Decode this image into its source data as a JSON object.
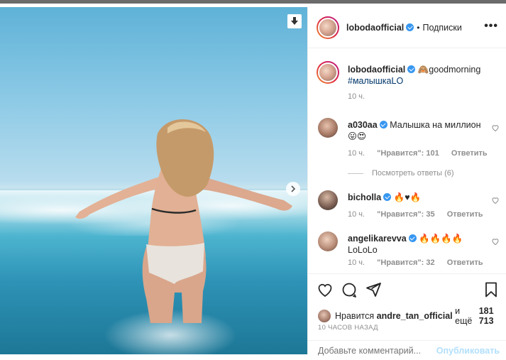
{
  "post": {
    "username": "lobodaofficial",
    "follow_label": "Подписки",
    "dot": "•",
    "more": "•••"
  },
  "caption": {
    "username": "lobodaofficial",
    "text": "🙈goodmorning",
    "hashtag": "#малышкаLO",
    "time": "10 ч."
  },
  "comments": [
    {
      "username": "a030aa",
      "text": "Малышка на миллион",
      "text2": "😛😍",
      "time": "10 ч.",
      "likes": "\"Нравится\": 101",
      "reply": "Ответить",
      "view_replies": "Посмотреть ответы (6)"
    },
    {
      "username": "bicholla",
      "text": "🔥♥🔥",
      "time": "10 ч.",
      "likes": "\"Нравится\": 35",
      "reply": "Ответить"
    },
    {
      "username": "angelikarevva",
      "text": "🔥🔥🔥🔥",
      "text2": "LoLoLo",
      "time": "10 ч.",
      "likes": "\"Нравится\": 32",
      "reply": "Ответить"
    }
  ],
  "likes_line": {
    "prefix": "Нравится",
    "user": "andre_tan_official",
    "middle": "и ещё",
    "count": "181 713"
  },
  "timestamp": "10 ЧАСОВ НАЗАД",
  "add_comment": {
    "placeholder": "Добавьте комментарий...",
    "post_label": "Опубликовать"
  },
  "icons": {
    "save": "download-arrow-icon",
    "next": "chevron-right-icon",
    "like": "heart-icon",
    "comment": "comment-icon",
    "share": "paper-plane-icon",
    "bookmark": "bookmark-icon"
  },
  "colors": {
    "verified": "#3897f0",
    "hashtag": "#00376b",
    "post_button": "#b2dffc",
    "muted": "#8e8e8e"
  }
}
